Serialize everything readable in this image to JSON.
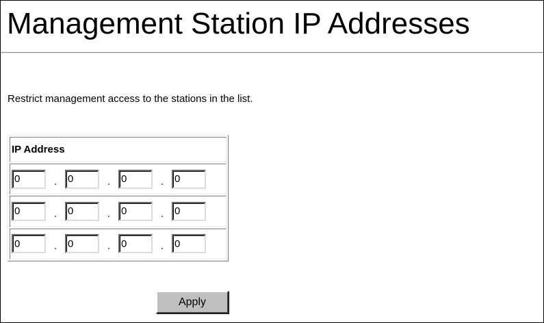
{
  "page": {
    "title": "Management Station IP Addresses",
    "description": "Restrict management access to the stations in the list."
  },
  "ip_table": {
    "header": "IP Address",
    "separator": ".",
    "rows": [
      [
        "0",
        "0",
        "0",
        "0"
      ],
      [
        "0",
        "0",
        "0",
        "0"
      ],
      [
        "0",
        "0",
        "0",
        "0"
      ]
    ]
  },
  "actions": {
    "apply_label": "Apply"
  },
  "colors": {
    "background": "#ffffff",
    "button_face": "#c0c0c0",
    "text": "#000000"
  }
}
